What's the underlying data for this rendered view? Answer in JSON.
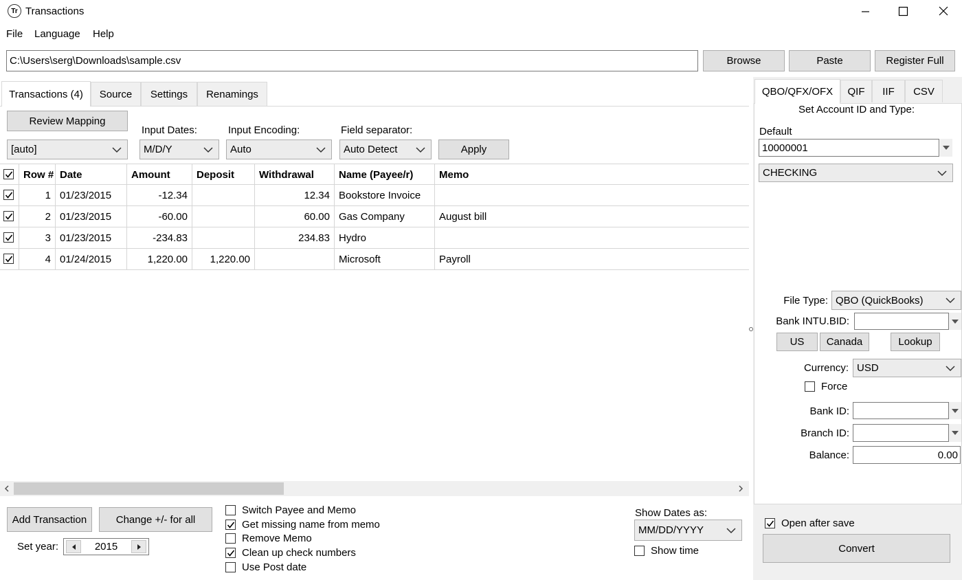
{
  "window": {
    "title": "Transactions",
    "app_icon_text": "Tr"
  },
  "menu": [
    "File",
    "Language",
    "Help"
  ],
  "path": {
    "value": "C:\\Users\\serg\\Downloads\\sample.csv"
  },
  "top_buttons": {
    "browse": "Browse",
    "paste": "Paste",
    "register": "Register Full"
  },
  "tabs": [
    "Transactions (4)",
    "Source",
    "Settings",
    "Renamings"
  ],
  "toolbar": {
    "review_mapping": "Review Mapping",
    "mapping_value": "[auto]",
    "input_dates_label": "Input Dates:",
    "input_dates_value": "M/D/Y",
    "input_encoding_label": "Input Encoding:",
    "input_encoding_value": "Auto",
    "field_separator_label": "Field separator:",
    "field_separator_value": "Auto Detect",
    "apply": "Apply"
  },
  "table": {
    "columns": [
      "Row #",
      "Date",
      "Amount",
      "Deposit",
      "Withdrawal",
      "Name (Payee/r)",
      "Memo"
    ],
    "rows": [
      {
        "checked": true,
        "row": "1",
        "date": "01/23/2015",
        "amount": "-12.34",
        "deposit": "",
        "withdrawal": "12.34",
        "name": "Bookstore Invoice",
        "memo": ""
      },
      {
        "checked": true,
        "row": "2",
        "date": "01/23/2015",
        "amount": "-60.00",
        "deposit": "",
        "withdrawal": "60.00",
        "name": "Gas Company",
        "memo": "August bill"
      },
      {
        "checked": true,
        "row": "3",
        "date": "01/23/2015",
        "amount": "-234.83",
        "deposit": "",
        "withdrawal": "234.83",
        "name": "Hydro",
        "memo": ""
      },
      {
        "checked": true,
        "row": "4",
        "date": "01/24/2015",
        "amount": "1,220.00",
        "deposit": "1,220.00",
        "withdrawal": "",
        "name": "Microsoft",
        "memo": "Payroll"
      }
    ]
  },
  "bottom": {
    "add_transaction": "Add Transaction",
    "change_sign": "Change +/- for all",
    "set_year_label": "Set year:",
    "year_value": "2015",
    "options": [
      {
        "label": "Switch Payee and Memo",
        "checked": false
      },
      {
        "label": "Get missing name from memo",
        "checked": true
      },
      {
        "label": "Remove Memo",
        "checked": false
      },
      {
        "label": "Clean up check numbers",
        "checked": true
      },
      {
        "label": "Use Post date",
        "checked": false
      }
    ],
    "show_dates_label": "Show Dates as:",
    "show_dates_value": "MM/DD/YYYY",
    "show_time_label": "Show time"
  },
  "right": {
    "tabs": [
      "QBO/QFX/OFX",
      "QIF",
      "IIF",
      "CSV"
    ],
    "set_account_label": "Set Account ID and Type:",
    "default_label": "Default",
    "account_id": "10000001",
    "account_type": "CHECKING",
    "file_type_label": "File Type:",
    "file_type_value": "QBO (QuickBooks)",
    "bank_intu_label": "Bank INTU.BID:",
    "us": "US",
    "canada": "Canada",
    "lookup": "Lookup",
    "currency_label": "Currency:",
    "currency_value": "USD",
    "force_label": "Force",
    "bank_id_label": "Bank ID:",
    "branch_id_label": "Branch ID:",
    "balance_label": "Balance:",
    "balance_value": "0.00",
    "open_after_save": "Open after save",
    "convert": "Convert"
  }
}
